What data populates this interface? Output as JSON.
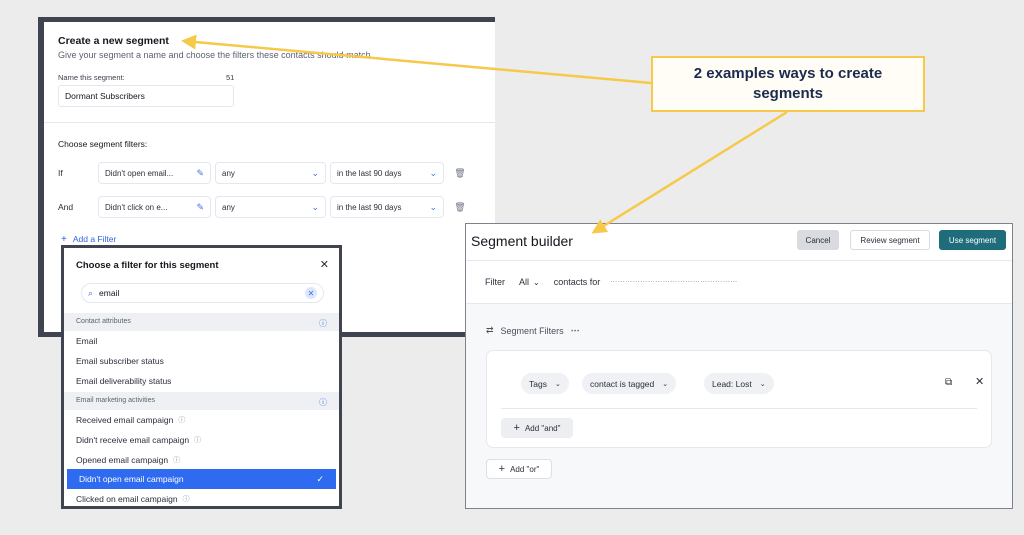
{
  "colors": {
    "callout_border": "#f6c94a",
    "arrow": "#f6c94a",
    "accent_blue": "#2f6bf0",
    "use_segment_bg": "#1f6d7a"
  },
  "callout": {
    "text": "2 examples ways to create segments"
  },
  "create_segment": {
    "title": "Create a new segment",
    "subtitle": "Give your segment a name and choose the filters these contacts should match.",
    "name_label": "Name this segment:",
    "name_count": "51",
    "name_value": "Dormant Subscribers",
    "filters_label": "Choose segment filters:",
    "rows": [
      {
        "label": "If",
        "field": "Didn't open email...",
        "operator": "any",
        "period": "in the last 90 days"
      },
      {
        "label": "And",
        "field": "Didn't click on e...",
        "operator": "any",
        "period": "in the last 90 days"
      }
    ],
    "add_filter": "Add a Filter"
  },
  "filter_dropdown": {
    "title": "Choose a filter for this segment",
    "search_value": "email",
    "sections": [
      {
        "label": "Contact attributes",
        "items": [
          "Email",
          "Email subscriber status",
          "Email deliverability status"
        ]
      },
      {
        "label": "Email marketing activities",
        "items": [
          "Received email campaign",
          "Didn't receive email campaign",
          "Opened email campaign",
          "Didn't open email campaign",
          "Clicked on email campaign"
        ]
      }
    ],
    "selected_item": "Didn't open email campaign"
  },
  "segment_builder": {
    "title": "Segment builder",
    "cancel": "Cancel",
    "review": "Review segment",
    "use": "Use segment",
    "filter_label": "Filter",
    "filter_value": "All",
    "contacts_for": "contacts for",
    "segment_filters": "Segment Filters",
    "pills": [
      "Tags",
      "contact is tagged",
      "Lead: Lost"
    ],
    "add_and": "Add \"and\"",
    "add_or": "Add \"or\""
  }
}
